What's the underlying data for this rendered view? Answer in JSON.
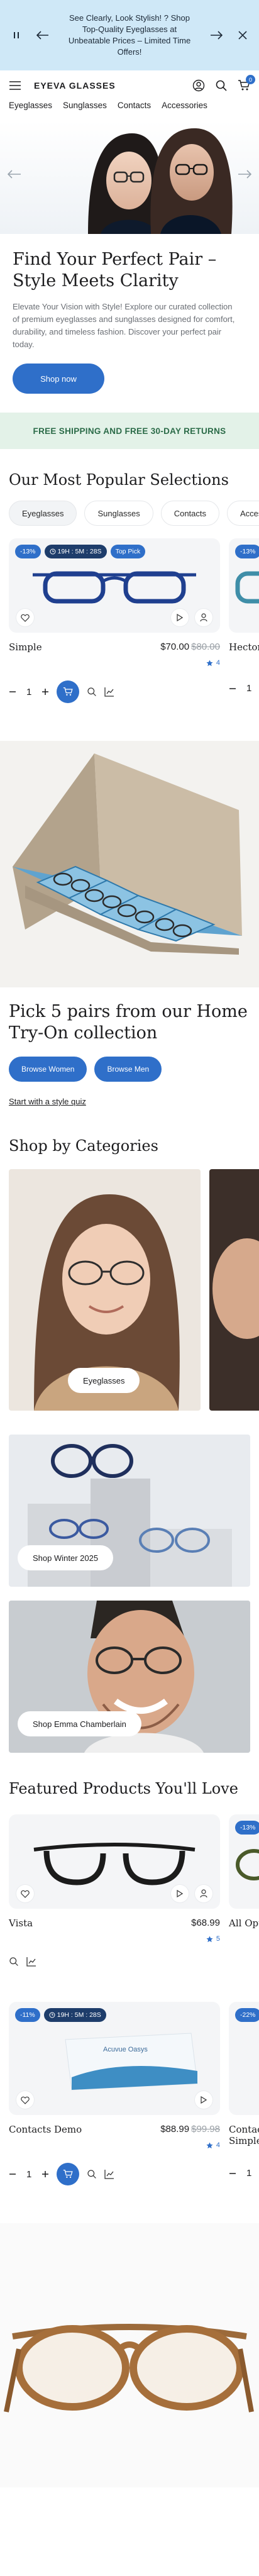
{
  "announcement": {
    "text": "See Clearly, Look Stylish! ? Shop Top-Quality Eyeglasses at Unbeatable Prices – Limited Time Offers!"
  },
  "header": {
    "logo": "EYEVA GLASSES",
    "cart_count": "0"
  },
  "nav": [
    "Eyeglasses",
    "Sunglasses",
    "Contacts",
    "Accessories"
  ],
  "hero": {
    "title": "Find Your Perfect Pair – Style Meets Clarity",
    "description": "Elevate Your Vision with Style! Explore our curated collection of premium eyeglasses and sunglasses designed for comfort, durability, and timeless fashion. Discover your perfect pair today.",
    "cta": "Shop now"
  },
  "shipping_banner": "FREE SHIPPING AND FREE 30-DAY RETURNS",
  "popular": {
    "title": "Our Most Popular Selections",
    "tabs": [
      "Eyeglasses",
      "Sunglasses",
      "Contacts",
      "Accessories"
    ],
    "products": [
      {
        "name": "Simple",
        "price": "$70.00",
        "old_price": "$80.00",
        "badge_discount": "-13%",
        "badge_timer": "19H : 5M : 28S",
        "badge_tag": "Top Pick",
        "rating": "4",
        "qty": "1"
      },
      {
        "name": "Hector",
        "badge_discount": "-13%",
        "qty": "1"
      }
    ]
  },
  "tryon": {
    "title": "Pick 5 pairs from our Home Try-On collection",
    "btn_women": "Browse Women",
    "btn_men": "Browse Men",
    "quiz_link": "Start with a style quiz"
  },
  "categories": {
    "title": "Shop by Categories",
    "tile_label": "Eyeglasses",
    "winter_label": "Shop Winter 2025",
    "emma_label": "Shop Emma Chamberlain"
  },
  "featured": {
    "title": "Featured Products You'll Love",
    "products": [
      {
        "name": "Vista",
        "price": "$68.99",
        "rating": "5",
        "badge_discount": "-13%"
      },
      {
        "name": "All Options"
      },
      {
        "name": "Contacts Demo",
        "price": "$88.99",
        "old_price": "$99.98",
        "badge_discount": "-11%",
        "badge_timer": "19H : 5M : 28S",
        "rating": "4",
        "qty": "1"
      },
      {
        "name": "Contacts Simple",
        "badge_discount": "-22%",
        "qty": "1"
      }
    ],
    "contacts_brand": "Acuvue Oasys"
  },
  "colors": {
    "accent": "#2f6fc9",
    "announce_bg": "#cfe8f7",
    "shipping_bg": "#e3f2e8",
    "shipping_text": "#2b6b48"
  }
}
